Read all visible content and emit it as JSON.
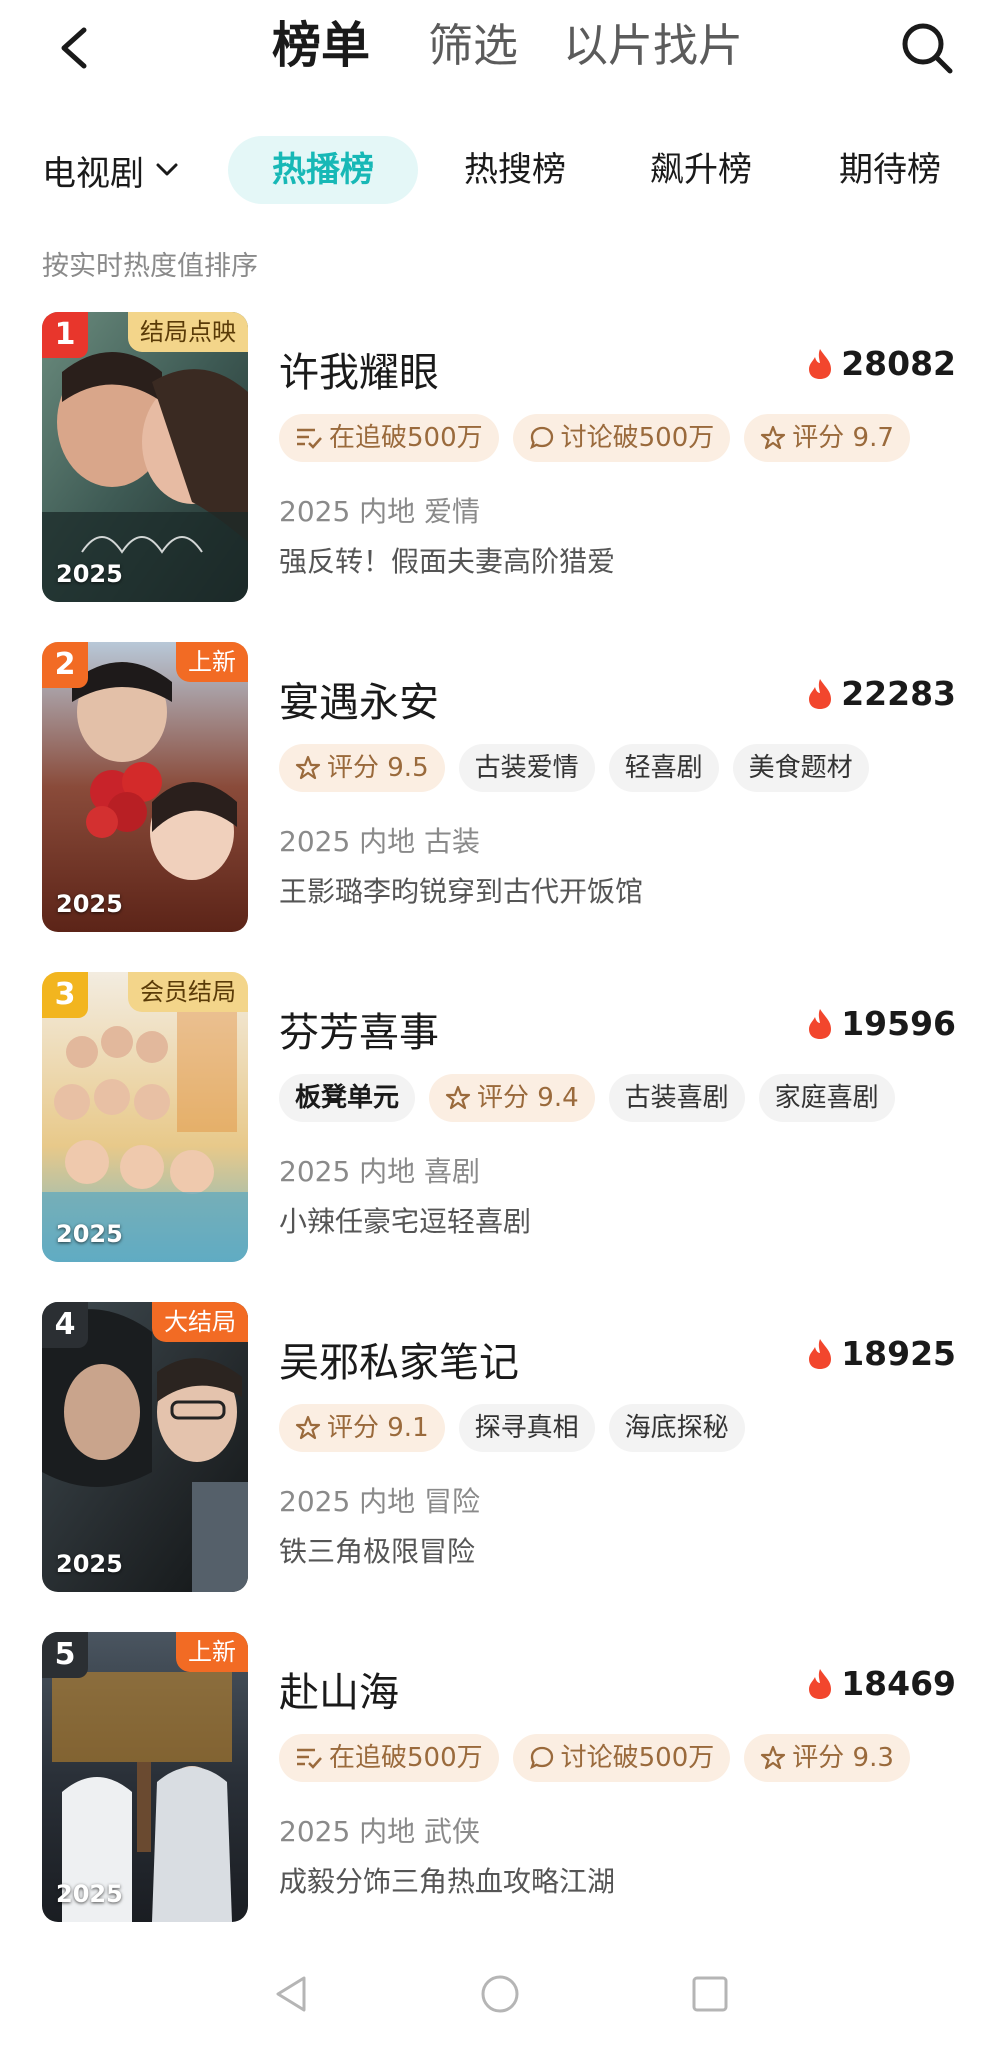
{
  "header": {
    "tabs": [
      {
        "label": "榜单",
        "active": true
      },
      {
        "label": "筛选",
        "active": false
      },
      {
        "label": "以片找片",
        "active": false
      }
    ]
  },
  "filter": {
    "category": "电视剧",
    "rank_tabs": [
      {
        "label": "热播榜",
        "active": true
      },
      {
        "label": "热搜榜",
        "active": false
      },
      {
        "label": "飙升榜",
        "active": false
      },
      {
        "label": "期待榜",
        "active": false
      }
    ]
  },
  "subtitle": "按实时热度值排序",
  "items": [
    {
      "rank": "1",
      "badge_color": "#e8362c",
      "status": "结局点映",
      "status_style": "gold",
      "year": "2025",
      "title": "许我耀眼",
      "heat": "28082",
      "tags": [
        "在追破500万",
        "讨论破500万",
        "评分 9.7"
      ],
      "meta": "2025 内地 爱情",
      "desc": "强反转！假面夫妻高阶猎爱"
    },
    {
      "rank": "2",
      "badge_color": "#f26b24",
      "status": "上新",
      "status_style": "orange",
      "year": "2025",
      "title": "宴遇永安",
      "heat": "22283",
      "tags": [
        "评分 9.5",
        "古装爱情",
        "轻喜剧",
        "美食题材"
      ],
      "meta": "2025 内地 古装",
      "desc": "王影璐李昀锐穿到古代开饭馆"
    },
    {
      "rank": "3",
      "badge_color": "#f2b51f",
      "status": "会员结局",
      "status_style": "gold",
      "year": "2025",
      "title": "芬芳喜事",
      "heat": "19596",
      "tags": [
        "板凳单元",
        "评分 9.4",
        "古装喜剧",
        "家庭喜剧"
      ],
      "meta": "2025 内地 喜剧",
      "desc": "小辣任豪宅逗轻喜剧"
    },
    {
      "rank": "4",
      "badge_color": "#2b2f33",
      "status": "大结局",
      "status_style": "orange",
      "year": "2025",
      "title": "吴邪私家笔记",
      "heat": "18925",
      "tags": [
        "评分 9.1",
        "探寻真相",
        "海底探秘"
      ],
      "meta": "2025 内地 冒险",
      "desc": "铁三角极限冒险"
    },
    {
      "rank": "5",
      "badge_color": "#2b2f33",
      "status": "上新",
      "status_style": "orange",
      "year": "2025",
      "title": "赴山海",
      "heat": "18469",
      "tags": [
        "在追破500万",
        "讨论破500万",
        "评分 9.3"
      ],
      "meta": "2025 内地 武侠",
      "desc": "成毅分饰三角热血攻略江湖"
    }
  ]
}
